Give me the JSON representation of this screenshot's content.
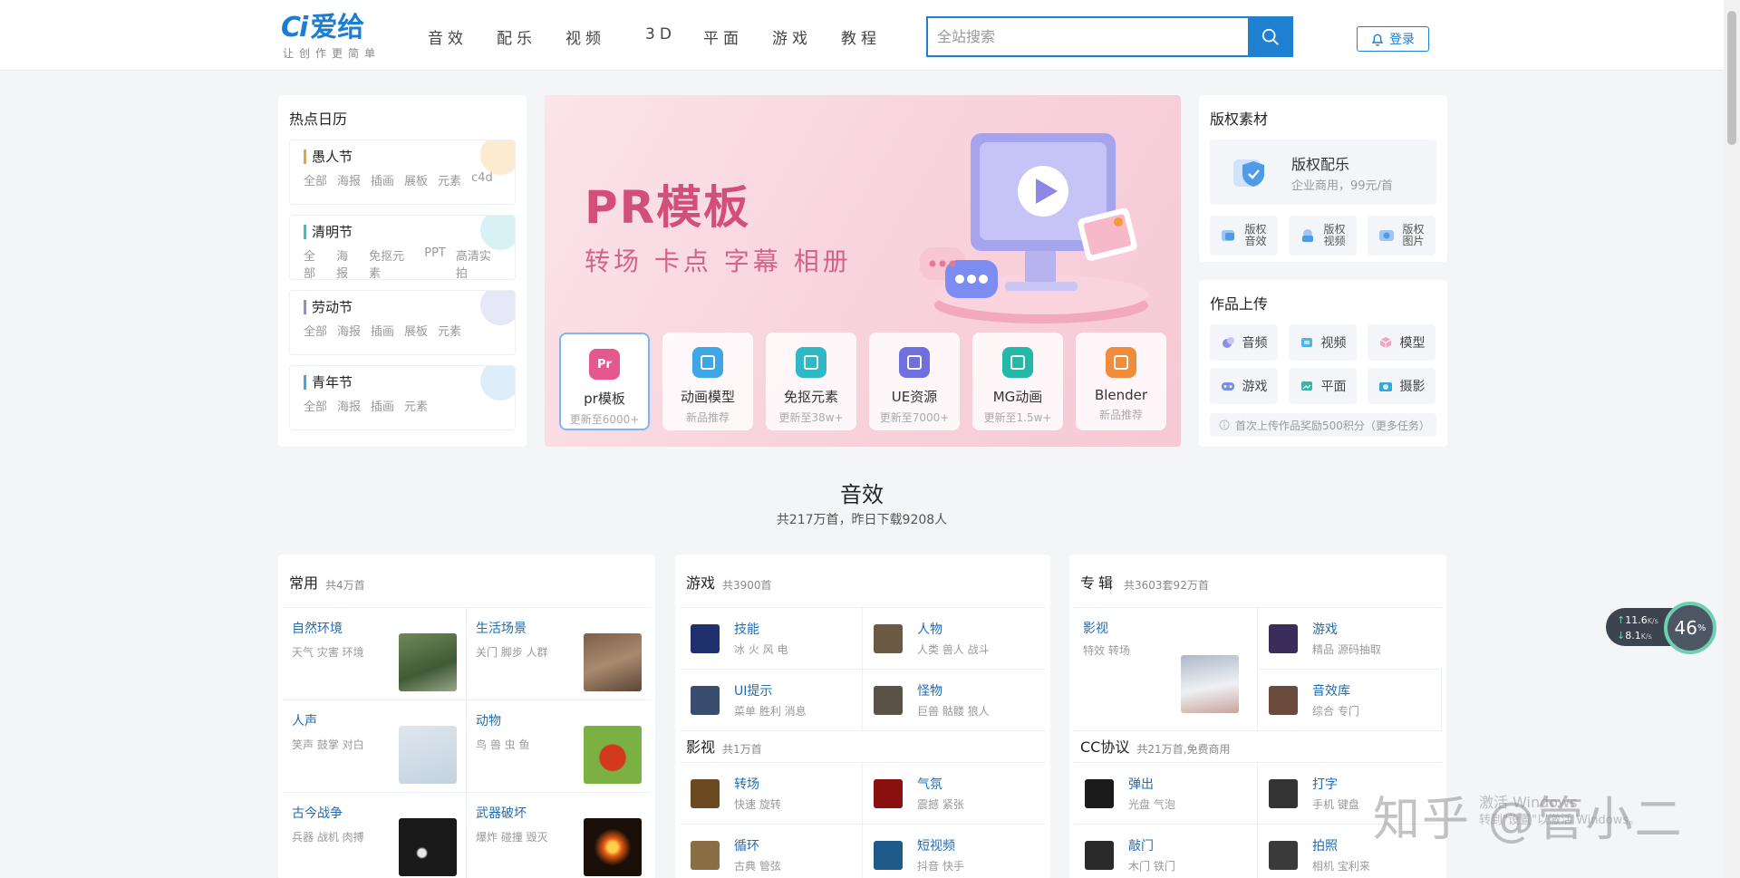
{
  "header": {
    "logo_text": "爱给",
    "logo_mark": "Ci",
    "slogan": "让创作更简单",
    "nav": [
      "音效",
      "配乐",
      "视频",
      "3D",
      "平面",
      "游戏",
      "教程"
    ],
    "search_placeholder": "全站搜索",
    "login_label": "登录",
    "accent": "#1f7fd0"
  },
  "calendar": {
    "title": "热点日历",
    "items": [
      {
        "name": "愚人节",
        "tags": [
          "全部",
          "海报",
          "插画",
          "展板",
          "元素",
          "c4d"
        ],
        "color": "#f0a23a"
      },
      {
        "name": "清明节",
        "tags": [
          "全部",
          "海报",
          "免抠元素",
          "PPT",
          "高清实拍"
        ],
        "color": "#3cbfc8"
      },
      {
        "name": "劳动节",
        "tags": [
          "全部",
          "海报",
          "插画",
          "展板",
          "元素"
        ],
        "color": "#8a92d6"
      },
      {
        "name": "青年节",
        "tags": [
          "全部",
          "海报",
          "插画",
          "元素"
        ],
        "color": "#4aa3df"
      }
    ]
  },
  "banner": {
    "title": "PR模板",
    "subtitle": "转场 卡点 字幕 相册",
    "cards": [
      {
        "label": "pr模板",
        "sub": "更新至6000+",
        "icon": "Pr",
        "color": "#e5578f"
      },
      {
        "label": "动画模型",
        "sub": "新品推荐",
        "icon": "cube-icon",
        "color": "#3ea6e6"
      },
      {
        "label": "免抠元素",
        "sub": "更新至38w+",
        "icon": "layer-icon",
        "color": "#2fb9c7"
      },
      {
        "label": "UE资源",
        "sub": "更新至7000+",
        "icon": "ue-icon",
        "color": "#6f6fe0"
      },
      {
        "label": "MG动画",
        "sub": "更新至1.5w+",
        "icon": "play-icon",
        "color": "#24b8a8"
      },
      {
        "label": "Blender",
        "sub": "新品推荐",
        "icon": "blender-icon",
        "color": "#f08d3c"
      }
    ]
  },
  "copyright": {
    "title": "版权素材",
    "main_title": "版权配乐",
    "main_sub": "企业商用，99元/首",
    "buttons": [
      "版权音效",
      "版权视频",
      "版权图片"
    ]
  },
  "upload": {
    "title": "作品上传",
    "buttons": [
      "音频",
      "视频",
      "模型",
      "游戏",
      "平面",
      "摄影"
    ],
    "note": "首次上传作品奖励500积分（更多任务）"
  },
  "section": {
    "title": "音效",
    "subtitle": "共217万首，昨日下载9208人"
  },
  "col1": {
    "title": "常用",
    "count": "共4万首",
    "items": [
      {
        "t": "自然环境",
        "s": "天气 灾害 环境"
      },
      {
        "t": "生活场景",
        "s": "关门 脚步 人群"
      },
      {
        "t": "人声",
        "s": "笑声 鼓掌 对白"
      },
      {
        "t": "动物",
        "s": "鸟 兽 虫 鱼"
      },
      {
        "t": "古今战争",
        "s": "兵器 战机 肉搏"
      },
      {
        "t": "武器破坏",
        "s": "爆炸 碰撞 毁灭"
      }
    ]
  },
  "col2": {
    "title": "游戏",
    "count": "共3900首",
    "items": [
      {
        "t": "技能",
        "s": "冰 火 风 电"
      },
      {
        "t": "人物",
        "s": "人类 兽人 战斗"
      },
      {
        "t": "UI提示",
        "s": "菜单 胜利 消息"
      },
      {
        "t": "怪物",
        "s": "巨兽 骷髅 狼人"
      }
    ],
    "title2": "影视",
    "count2": "共1万首",
    "items2": [
      {
        "t": "转场",
        "s": "快速 旋转"
      },
      {
        "t": "气氛",
        "s": "震撼 紧张"
      },
      {
        "t": "循环",
        "s": "古典 管弦"
      },
      {
        "t": "短视频",
        "s": "抖音 快手"
      }
    ]
  },
  "col3": {
    "title": "专辑",
    "count": "共3603套92万首",
    "items": [
      {
        "t": "影视",
        "s": "特效 转场"
      },
      {
        "t": "游戏",
        "s": "精品 源码抽取"
      },
      {
        "t": "音效库",
        "s": "综合 专门"
      }
    ],
    "title2": "CC协议",
    "count2": "共21万首,免费商用",
    "items2": [
      {
        "t": "弹出",
        "s": "光盘 气泡"
      },
      {
        "t": "打字",
        "s": "手机 键盘"
      },
      {
        "t": "敲门",
        "s": "木门 铁门"
      },
      {
        "t": "拍照",
        "s": "相机 宝利来"
      }
    ]
  },
  "speed": {
    "up": "11.6",
    "down": "8.1",
    "unit": "K/s",
    "percent": "46",
    "percent_unit": "%"
  },
  "watermark": {
    "text": "知乎 @管小二",
    "win1": "激活 Windows",
    "win2": "转到\"设置\"以激活 Windows。"
  }
}
